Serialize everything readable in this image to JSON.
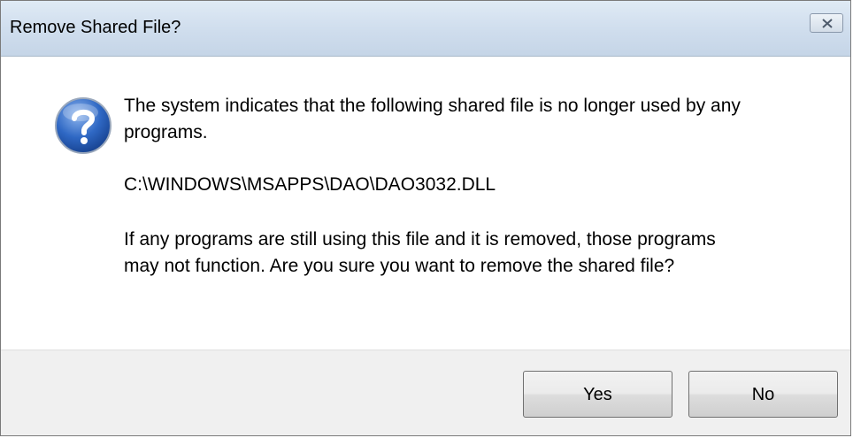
{
  "dialog": {
    "title": "Remove Shared File?",
    "icon": "question-icon",
    "message_intro": "The system indicates that the following shared file is no longer used by any programs.",
    "file_path": "C:\\WINDOWS\\MSAPPS\\DAO\\DAO3032.DLL",
    "message_warning": "If any programs are still using this file and it is removed, those programs may not function.  Are you sure you want to remove the shared file?"
  },
  "buttons": {
    "yes_label": "Yes",
    "no_label": "No"
  },
  "colors": {
    "title_bar": "#cfdded",
    "footer": "#f0f0f0",
    "icon_blue": "#2a62c0"
  }
}
